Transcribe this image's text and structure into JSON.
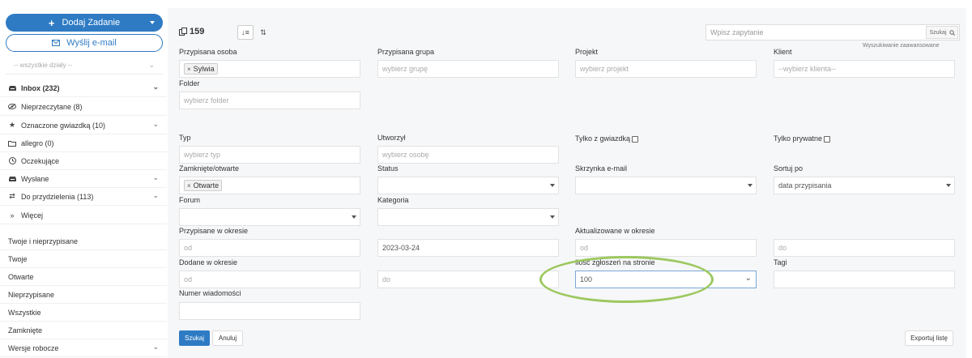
{
  "sidebar": {
    "add_task": "Dodaj Zadanie",
    "send_email": "Wyślij e-mail",
    "departments": "-- wszystkie działy --",
    "nav": [
      {
        "label": "Inbox (232)",
        "icon": "inbox-icon",
        "chevron": true
      },
      {
        "label": "Nieprzeczytane (8)",
        "icon": "eye-icon",
        "chevron": false
      },
      {
        "label": "Oznaczone gwiazdką (10)",
        "icon": "star-icon",
        "chevron": true
      },
      {
        "label": "allegro (0)",
        "icon": "folder-icon",
        "chevron": false
      },
      {
        "label": "Oczekujące",
        "icon": "clock-icon",
        "chevron": false
      },
      {
        "label": "Wysłane",
        "icon": "outbox-icon",
        "chevron": true
      },
      {
        "label": "Do przydzielenia (113)",
        "icon": "transfer-icon",
        "chevron": true
      },
      {
        "label": "Więcej",
        "icon": "double-chevron-icon",
        "chevron": false
      }
    ],
    "filters": [
      {
        "label": "Twoje i nieprzypisane"
      },
      {
        "label": "Twoje"
      },
      {
        "label": "Otwarte"
      },
      {
        "label": "Nieprzypisane"
      },
      {
        "label": "Wszystkie"
      },
      {
        "label": "Zamknięte"
      },
      {
        "label": "Wersje robocze",
        "chevron": true
      }
    ]
  },
  "toolbar": {
    "count": "159",
    "search_placeholder": "Wpisz zapytanie",
    "search_button": "Szukaj",
    "advanced_search": "Wyszukiwanie zaawansowane"
  },
  "form": {
    "assigned_person": {
      "label": "Przypisana osoba",
      "tag": "Sylwia"
    },
    "assigned_group": {
      "label": "Przypisana grupa",
      "placeholder": "wybierz grupę"
    },
    "project": {
      "label": "Projekt",
      "placeholder": "wybierz projekt"
    },
    "client": {
      "label": "Klient",
      "placeholder": "--wybierz klienta--"
    },
    "folder": {
      "label": "Folder",
      "placeholder": "wybierz folder"
    },
    "type": {
      "label": "Typ",
      "placeholder": "wybierz typ"
    },
    "created_by": {
      "label": "Utworzył",
      "placeholder": "wybierz osobę"
    },
    "only_starred": {
      "label": "Tylko z gwiazdką"
    },
    "only_private": {
      "label": "Tylko prywatne"
    },
    "closed_open": {
      "label": "Zamknięte/otwarte",
      "tag": "Otwarte"
    },
    "status": {
      "label": "Status"
    },
    "mailbox": {
      "label": "Skrzynka e-mail"
    },
    "sort_by": {
      "label": "Sortuj po",
      "value": "data przypisania"
    },
    "forum": {
      "label": "Forum"
    },
    "category": {
      "label": "Kategoria"
    },
    "assigned_period": {
      "label": "Przypisane w okresie",
      "from": "od",
      "to": "2023-03-24"
    },
    "updated_period": {
      "label": "Aktualizowane w okresie",
      "from": "od",
      "to": "do"
    },
    "added_period": {
      "label": "Dodane w okresie",
      "from": "od",
      "to": "do"
    },
    "per_page": {
      "label": "Ilość zgłoszeń na stronie",
      "value": "100"
    },
    "tags": {
      "label": "Tagi"
    },
    "message_number": {
      "label": "Numer wiadomości"
    }
  },
  "actions": {
    "search": "Szukaj",
    "cancel": "Anuluj",
    "export": "Exportuj listę"
  },
  "colors": {
    "accent": "#2e7bc4",
    "highlight": "#9cc85f"
  }
}
